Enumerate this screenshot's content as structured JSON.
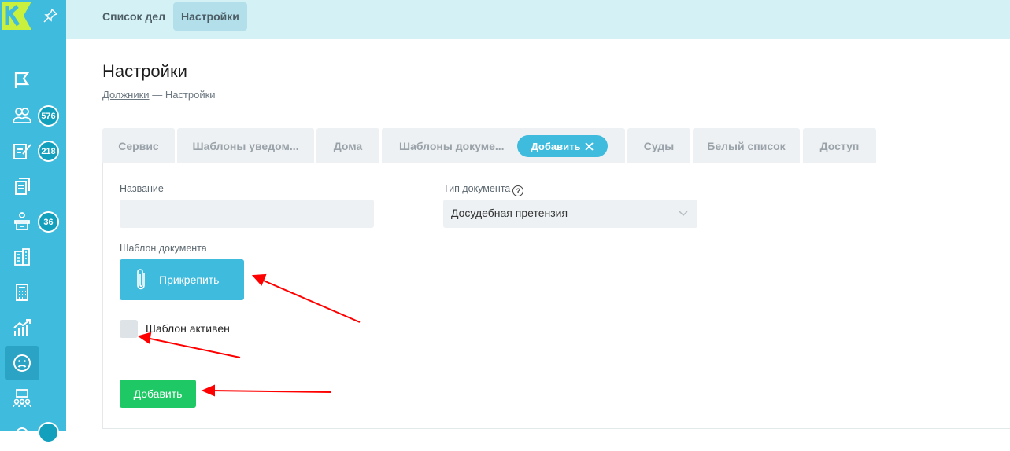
{
  "colors": {
    "sidebar": "#3fbbdd",
    "accent": "#3fbbdd",
    "submit": "#1ec864",
    "annotation": "#ff0000"
  },
  "sidebar": {
    "items": [
      {
        "icon": "flag-icon"
      },
      {
        "icon": "people-group-icon",
        "badge": "576"
      },
      {
        "icon": "edit-document-icon",
        "badge": "218"
      },
      {
        "icon": "documents-icon"
      },
      {
        "icon": "court-bench-icon",
        "badge": "36"
      },
      {
        "icon": "building-icon"
      },
      {
        "icon": "calculator-icon"
      },
      {
        "icon": "chart-growth-icon"
      },
      {
        "icon": "sad-face-icon"
      },
      {
        "icon": "team-icon"
      }
    ]
  },
  "topbar": {
    "tabs": [
      "Список дел",
      "Настройки"
    ],
    "active": "Настройки"
  },
  "page": {
    "title": "Настройки",
    "breadcrumb_link": "Должники",
    "breadcrumb_sep": " — ",
    "breadcrumb_current": "Настройки"
  },
  "tabs": [
    "Сервис",
    "Шаблоны уведом...",
    "Дома",
    "Шаблоны докуме...",
    "Суды",
    "Белый список",
    "Доступ"
  ],
  "add_pill": "Добавить",
  "form": {
    "name_label": "Название",
    "name_value": "",
    "doc_type_label": "Тип документа",
    "doc_type_help": "?",
    "doc_type_value": "Досудебная претензия",
    "template_label": "Шаблон документа",
    "attach_label": "Прикрепить",
    "active_label": "Шаблон активен",
    "submit_label": "Добавить"
  }
}
